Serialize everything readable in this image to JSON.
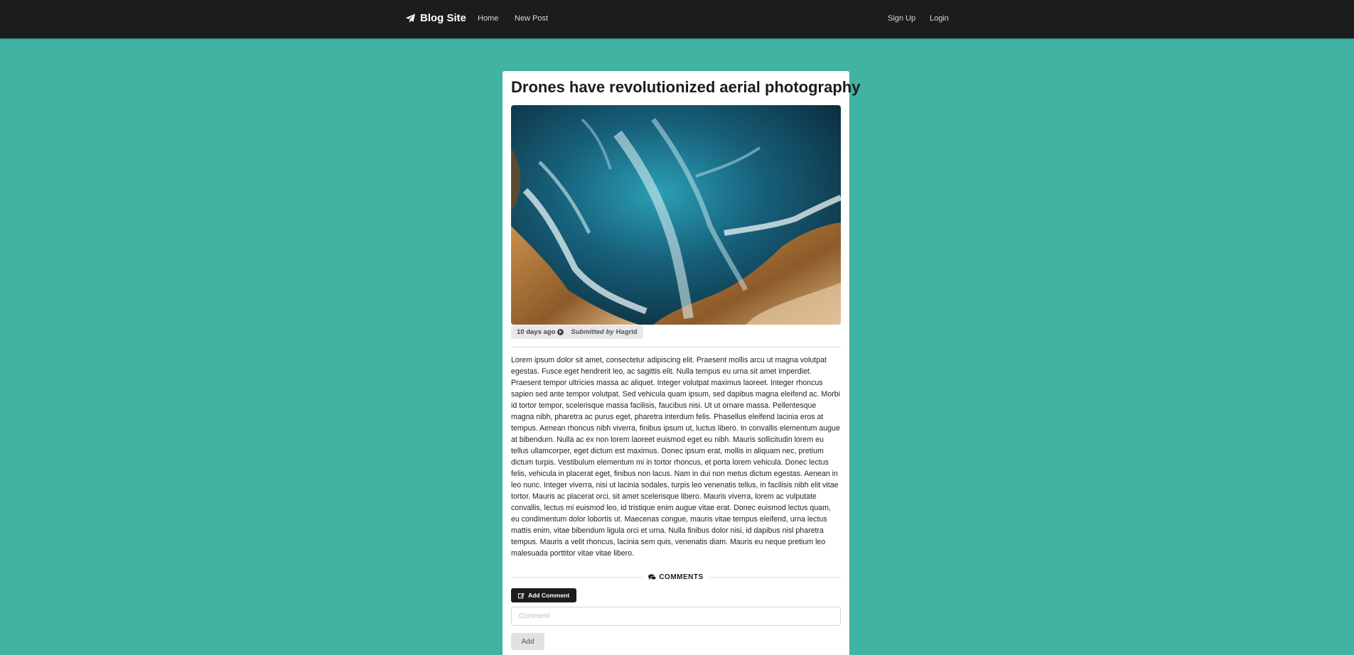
{
  "navbar": {
    "brand": "Blog Site",
    "links": [
      "Home",
      "New Post"
    ],
    "right_links": [
      "Sign Up",
      "Login"
    ]
  },
  "post": {
    "title": "Drones have revolutionized aerial photography",
    "image_icon": "aerial-ocean-photo",
    "time_ago": "10 days ago",
    "submitted_by_label": "Submitted by",
    "author": "Hagrid",
    "body": "Lorem ipsum dolor sit amet, consectetur adipiscing elit. Praesent mollis arcu ut magna volutpat egestas. Fusce eget hendrerit leo, ac sagittis elit. Nulla tempus eu urna sit amet imperdiet. Praesent tempor ultricies massa ac aliquet. Integer volutpat maximus laoreet. Integer rhoncus sapien sed ante tempor volutpat. Sed vehicula quam ipsum, sed dapibus magna eleifend ac. Morbi id tortor tempor, scelerisque massa facilisis, faucibus nisi. Ut ut ornare massa. Pellentesque magna nibh, pharetra ac purus eget, pharetra interdum felis. Phasellus eleifend lacinia eros at tempus. Aenean rhoncus nibh viverra, finibus ipsum ut, luctus libero. In convallis elementum augue at bibendum. Nulla ac ex non lorem laoreet euismod eget eu nibh. Mauris sollicitudin lorem eu tellus ullamcorper, eget dictum est maximus. Donec ipsum erat, mollis in aliquam nec, pretium dictum turpis. Vestibulum elementum mi in tortor rhoncus, et porta lorem vehicula. Donec lectus felis, vehicula in placerat eget, finibus non lacus. Nam in dui non metus dictum egestas. Aenean in leo nunc. Integer viverra, nisi ut lacinia sodales, turpis leo venenatis tellus, in facilisis nibh elit vitae tortor. Mauris ac placerat orci, sit amet scelerisque libero. Mauris viverra, lorem ac vulputate convallis, lectus mi euismod leo, id tristique enim augue vitae erat. Donec euismod lectus quam, eu condimentum dolor lobortis ut. Maecenas congue, mauris vitae tempus eleifend, urna lectus mattis enim, vitae bibendum ligula orci et urna. Nulla finibus dolor nisi, id dapibus nisl pharetra tempus. Mauris a velit rhoncus, lacinia sem quis, venenatis diam. Mauris eu neque pretium leo malesuada porttitor vitae vitae libero."
  },
  "comments": {
    "header": "COMMENTS",
    "add_comment_label": "Add Comment",
    "input_placeholder": "Comment",
    "add_button_label": "Add"
  },
  "colors": {
    "background": "#40b3a2",
    "navbar": "#1b1c1d",
    "card": "#ffffff"
  }
}
